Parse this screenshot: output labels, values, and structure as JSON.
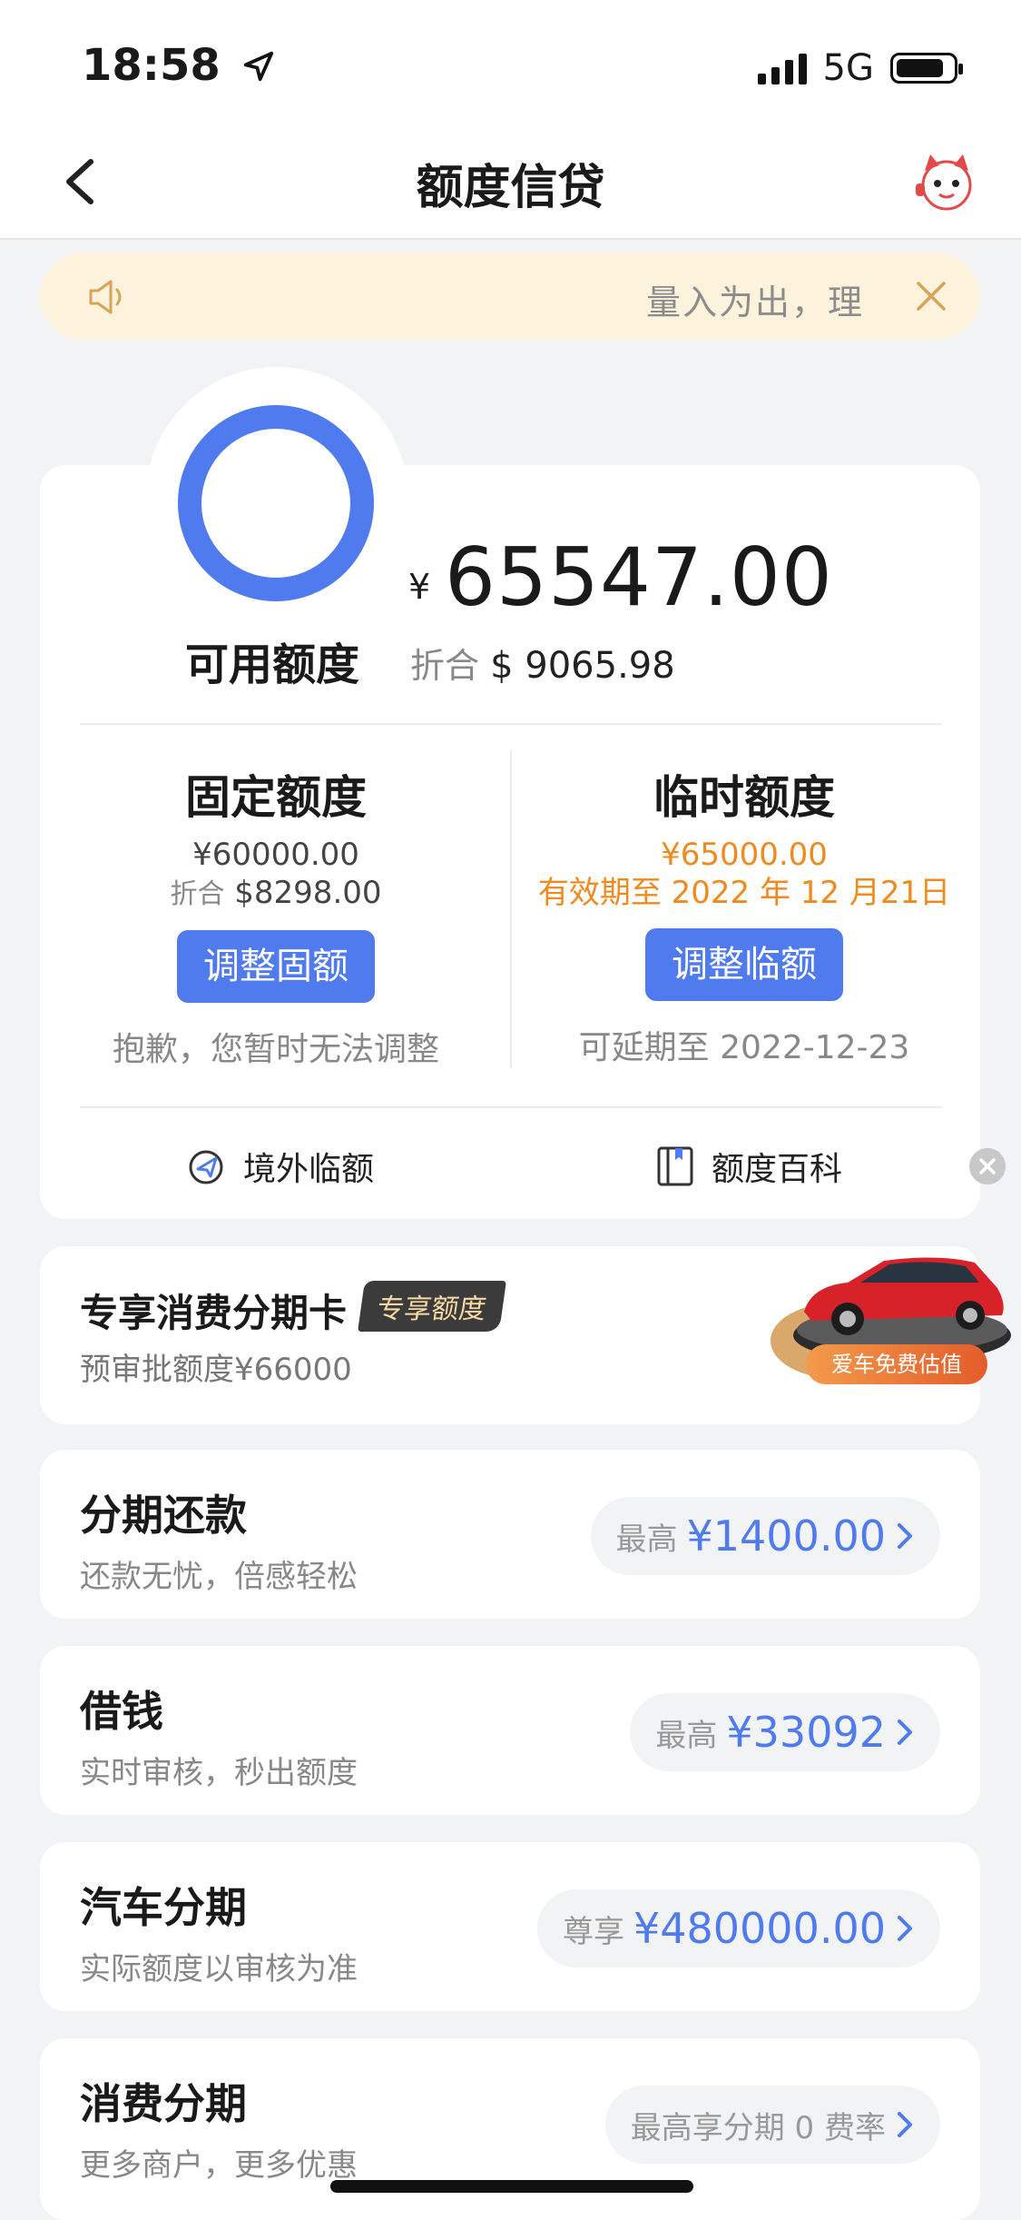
{
  "status": {
    "time": "18:58",
    "network": "5G",
    "battery_level": 0.85
  },
  "nav": {
    "title": "额度信贷"
  },
  "notice": {
    "text": "量入为出，理"
  },
  "credit": {
    "yen_symbol": "¥",
    "available_amount": "65547.00",
    "available_label": "可用额度",
    "converted_prefix": "折合",
    "converted_value": "$ 9065.98"
  },
  "fixed": {
    "title": "固定额度",
    "amount": "¥60000.00",
    "conv_prefix": "折合",
    "conv_value": "$8298.00",
    "button": "调整固额",
    "note": "抱歉，您暂时无法调整"
  },
  "temporary": {
    "title": "临时额度",
    "amount": "¥65000.00",
    "validity": "有效期至 2022 年 12 月21日",
    "button": "调整临额",
    "note": "可延期至 2022-12-23"
  },
  "links": {
    "overseas": "境外临额",
    "wiki": "额度百科"
  },
  "promo": {
    "title": "专享消费分期卡",
    "tag": "专享额度",
    "subtitle": "预审批额度¥66000",
    "car_label": "爱车免费估值"
  },
  "rows": [
    {
      "title": "分期还款",
      "subtitle": "还款无忧，倍感轻松",
      "prefix": "最高",
      "value": "¥1400.00"
    },
    {
      "title": "借钱",
      "subtitle": "实时审核，秒出额度",
      "prefix": "最高",
      "value": "¥33092"
    },
    {
      "title": "汽车分期",
      "subtitle": "实际额度以审核为准",
      "prefix": "尊享",
      "value": "¥480000.00"
    },
    {
      "title": "消费分期",
      "subtitle": "更多商户，更多优惠",
      "text": "最高享分期 0 费率"
    }
  ],
  "colors": {
    "accent": "#4f7bef",
    "warning": "#f08a1e",
    "notice_bg": "#fdf3dc"
  },
  "icons": [
    "location-arrow-icon",
    "signal-icon",
    "battery-icon",
    "back-chevron-icon",
    "mascot-icon",
    "speaker-icon",
    "close-icon",
    "overseas-icon",
    "book-icon",
    "chevron-right-icon",
    "car-image"
  ]
}
